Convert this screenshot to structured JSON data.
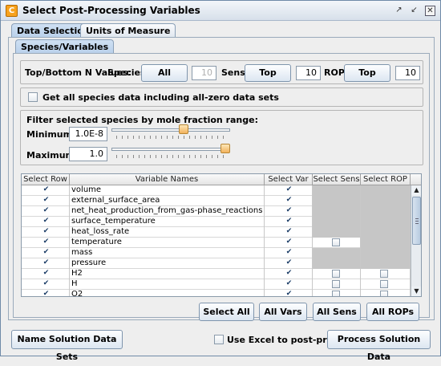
{
  "window": {
    "title": "Select Post-Processing Variables",
    "icon": "app-logo-icon"
  },
  "tabs": {
    "main": [
      "Data Selection",
      "Units of Measure"
    ],
    "sub": "Species/Variables"
  },
  "topN": {
    "label": "Top/Bottom N Values:",
    "species_label": "Species",
    "species_button": "All",
    "species_value": "10",
    "sens_label": "Sens",
    "sens_button": "Top",
    "sens_value": "10",
    "rop_label": "ROP",
    "rop_button": "Top",
    "rop_value": "10"
  },
  "zero_data": {
    "label": "Get all species data including all-zero data sets",
    "checked": false
  },
  "filter": {
    "title": "Filter selected species by mole fraction range:",
    "min_label": "Minimum",
    "min_value": "1.0E-8",
    "min_slider": 0.62,
    "max_label": "Maximum",
    "max_value": "1.0",
    "max_slider": 1.0
  },
  "table": {
    "headers": [
      "Select Row",
      "Variable Names",
      "Select Var",
      "Select Sens",
      "Select ROP"
    ],
    "rows": [
      {
        "name": "volume",
        "sens": "none",
        "rop": "none"
      },
      {
        "name": "external_surface_area",
        "sens": "none",
        "rop": "none"
      },
      {
        "name": "net_heat_production_from_gas-phase_reactions",
        "sens": "none",
        "rop": "none"
      },
      {
        "name": "surface_temperature",
        "sens": "none",
        "rop": "none"
      },
      {
        "name": "heat_loss_rate",
        "sens": "none",
        "rop": "none"
      },
      {
        "name": "temperature",
        "sens": "box",
        "rop": "none"
      },
      {
        "name": "mass",
        "sens": "none",
        "rop": "none"
      },
      {
        "name": "pressure",
        "sens": "none",
        "rop": "none"
      },
      {
        "name": "H2",
        "sens": "box",
        "rop": "box"
      },
      {
        "name": "H",
        "sens": "box",
        "rop": "box"
      },
      {
        "name": "O2",
        "sens": "box",
        "rop": "box"
      }
    ]
  },
  "select_buttons": [
    "Select All",
    "All Vars",
    "All Sens",
    "All ROPs"
  ],
  "bottom": {
    "name_button": "Name Solution Data Sets",
    "excel_label": "Use Excel to post-process",
    "process_button": "Process Solution Data"
  },
  "colors": {
    "accent": "#f7a21d",
    "tab_active": "#cfe0f3",
    "disabled_cell": "#c6c6c6"
  }
}
